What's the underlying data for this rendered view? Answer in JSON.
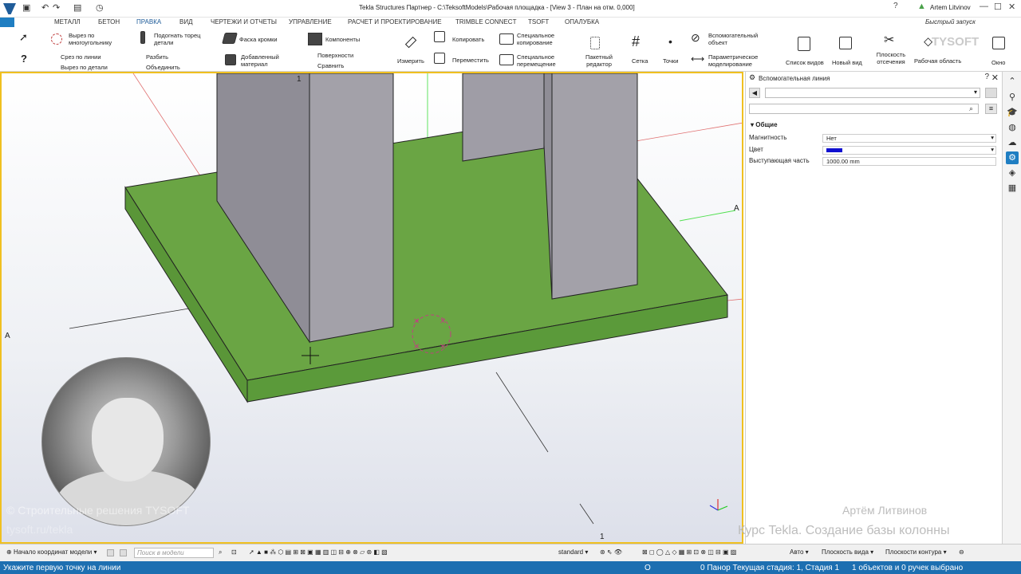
{
  "title": {
    "window_title": "Tekla Structures Партнер - C:\\TeksoftModels\\Рабочая площадка - [View 3 - План на отм. 0,000]",
    "user": "Artem Litvinov",
    "quick_search_placeholder": "Быстрый запуск",
    "help_icon": "?",
    "minimize": "—",
    "restore": "☐",
    "close": "✕"
  },
  "menu": [
    "МЕТАЛЛ",
    "БЕТОН",
    "ПРАВКА",
    "ВИД",
    "ЧЕРТЕЖИ И ОТЧЕТЫ",
    "УПРАВЛЕНИЕ",
    "РАСЧЕТ И ПРОЕКТИРОВАНИЕ",
    "TRIMBLE CONNECT",
    "TSOFT",
    "ОПАЛУБКА"
  ],
  "menu_active": "ПРАВКА",
  "ribbon": {
    "cut_polygon": "Вырез по многоугольнику",
    "cut_line": "Срез по линии",
    "cut_part": "Вырез по детали",
    "fit_end": "Подогнать торец детали",
    "split": "Разбить",
    "combine": "Объединить",
    "chamfer": "Фаска кромки",
    "add_material": "Добавленный материал",
    "components": "Компоненты",
    "surfaces": "Поверхности",
    "compare": "Сравнить",
    "measure": "Измерить",
    "copy": "Копировать",
    "move": "Переместить",
    "special_copy": "Специальное копирование",
    "special_move": "Специальное перемещение",
    "batch_editor": "Пакетный редактор",
    "grid": "Сетка",
    "points": "Точки",
    "helper_object": "Вспомогательный объект",
    "param_modeling": "Параметрическое моделирование",
    "view_list": "Список видов",
    "new_view": "Новый вид",
    "clip_plane": "Плоскость отсечения",
    "work_area": "Рабочая область",
    "window": "Окно"
  },
  "viewport": {
    "grid_labels": [
      "1",
      "A",
      "A",
      "1"
    ],
    "course_watermark": "Курс Tekla. Создание базы колонны",
    "author_watermark": "Артём Литвинов",
    "company_watermark": "© Строительные решения TYSOFT",
    "company_watermark2": "tysoft.ru/tekla",
    "brand_watermark": "TYSOFT"
  },
  "panel": {
    "title": "Вспомогательная линия",
    "section": "Общие",
    "props": [
      {
        "label": "Магнитность",
        "value": "Нет"
      },
      {
        "label": "Цвет",
        "value": ""
      },
      {
        "label": "Выступающая часть",
        "value": "1000.00 mm"
      }
    ],
    "color_value": "#1010d0"
  },
  "bottom": {
    "origin": "Начало координат модели",
    "search_placeholder": "Поиск в модели",
    "view_filter": "standard",
    "auto": "Авто",
    "view_planes": "Плоскость вида",
    "contour_planes": "Плоскости контура"
  },
  "status": {
    "prompt": "Укажите первую точку на линии",
    "o_label": "O",
    "pan_stage": "0  Панор Текущая стадия: 1, Стадия 1",
    "selection": "1 объектов и 0 ручек выбрано"
  },
  "colors": {
    "accent": "#1f7ec2",
    "slab": "#6aa544",
    "column": "#9e9ca4",
    "viewport_border": "#f0c020"
  }
}
